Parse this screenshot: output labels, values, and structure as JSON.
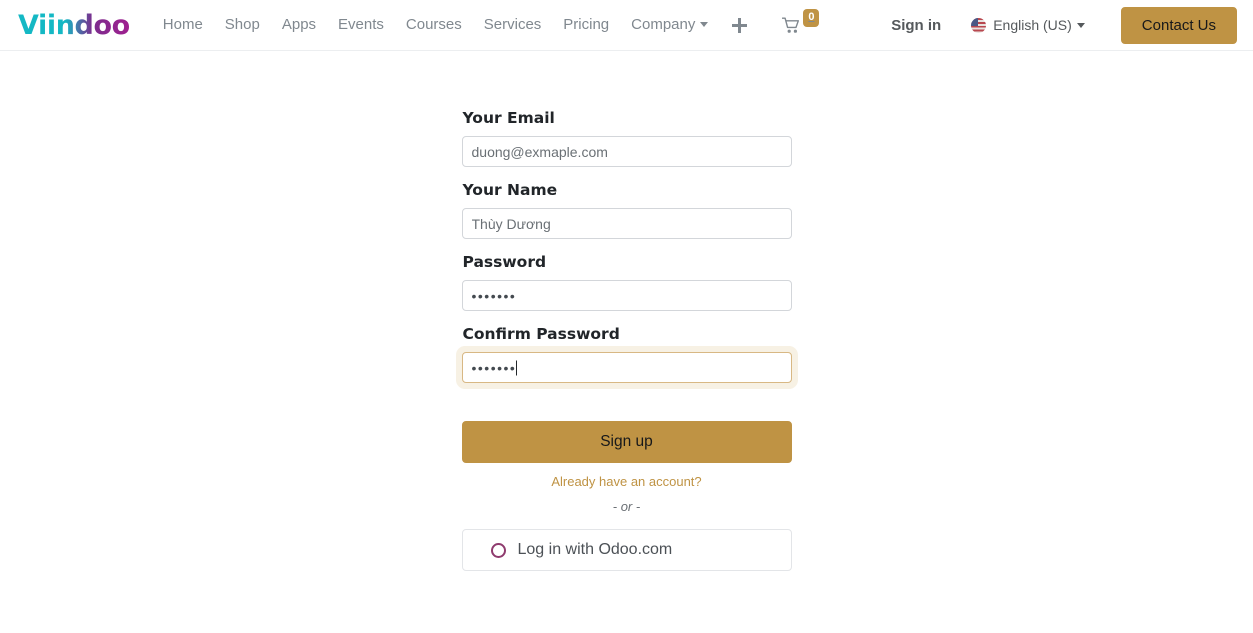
{
  "brand": {
    "name": "Viindoo"
  },
  "nav": {
    "items": [
      {
        "label": "Home",
        "dropdown": false
      },
      {
        "label": "Shop",
        "dropdown": false
      },
      {
        "label": "Apps",
        "dropdown": false
      },
      {
        "label": "Events",
        "dropdown": false
      },
      {
        "label": "Courses",
        "dropdown": false
      },
      {
        "label": "Services",
        "dropdown": false
      },
      {
        "label": "Pricing",
        "dropdown": false
      },
      {
        "label": "Company",
        "dropdown": true
      }
    ],
    "plus_icon": "plus-icon",
    "cart": {
      "icon": "shopping-cart-icon",
      "count": "0"
    }
  },
  "nav_right": {
    "sign_in": "Sign in",
    "language": {
      "label": "English (US)",
      "flag": "us-flag-icon"
    },
    "contact_button": "Contact Us"
  },
  "form": {
    "email": {
      "label": "Your Email",
      "value": "duong@exmaple.com",
      "placeholder": "Your Email"
    },
    "name": {
      "label": "Your Name",
      "value": "Thùy Dương",
      "placeholder": "Your Name"
    },
    "password": {
      "label": "Password",
      "value": "•••••••",
      "placeholder": "Password"
    },
    "confirm_password": {
      "label": "Confirm Password",
      "value": "•••••••",
      "placeholder": "Confirm Password",
      "focused": true
    },
    "submit_button": "Sign up",
    "already_link": "Already have an account?",
    "separator": "- or -",
    "oauth_button": {
      "label": "Log in with Odoo.com",
      "icon": "odoo-circle-icon"
    }
  },
  "colors": {
    "accent_gold": "#bf9344",
    "brand_teal": "#14b8c4",
    "brand_purple": "#a01f8f",
    "odoo_purple": "#8f3b6e"
  }
}
